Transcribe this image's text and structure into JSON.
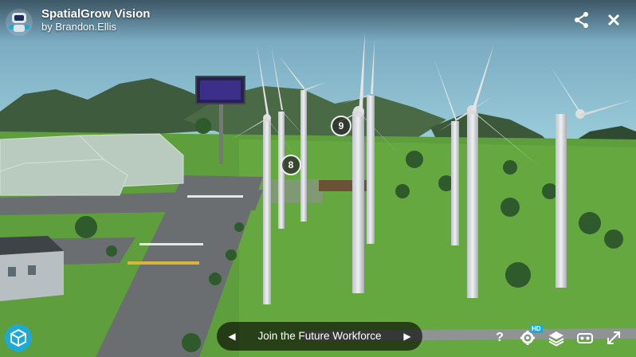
{
  "header": {
    "title": "SpatialGrow Vision",
    "author_prefix": "by",
    "author_name": "Brandon.Ellis",
    "share_icon": "share-icon",
    "close_icon": "close-icon"
  },
  "hotspots": [
    {
      "number": "9"
    },
    {
      "number": "8"
    }
  ],
  "annotation": {
    "label": "Join the Future Workforce",
    "prev_icon": "chevron-left-icon",
    "next_icon": "chevron-right-icon"
  },
  "toolbar": {
    "help_label": "?",
    "hd_badge": "HD",
    "icons": [
      "help-icon",
      "settings-icon",
      "layers-icon",
      "vr-icon",
      "fullscreen-icon"
    ]
  },
  "colors": {
    "accent": "#1caad9",
    "sky": "#8cc6d6",
    "grass": "#5fa33c",
    "hills": "#3d5a3c",
    "road": "#6b6e70"
  }
}
